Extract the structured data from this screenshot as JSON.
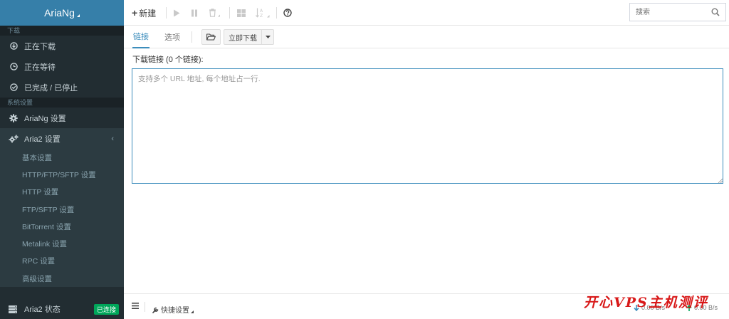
{
  "app": {
    "title": "AriaNg"
  },
  "sidebar": {
    "download_header": "下载",
    "downloading": "正在下载",
    "waiting": "正在等待",
    "stopped": "已完成 / 已停止",
    "settings_header": "系统设置",
    "ariang_settings": "AriaNg 设置",
    "aria2_settings": "Aria2 设置",
    "sub_items": [
      "基本设置",
      "HTTP/FTP/SFTP 设置",
      "HTTP 设置",
      "FTP/SFTP 设置",
      "BitTorrent 设置",
      "Metalink 设置",
      "RPC 设置",
      "高级设置"
    ],
    "aria2_status": "Aria2 状态",
    "status_badge": "已连接"
  },
  "toolbar": {
    "new_label": "新建",
    "search_placeholder": "搜索"
  },
  "tabs": {
    "links": "链接",
    "options": "选项",
    "download_now": "立即下载"
  },
  "content": {
    "links_label": "下载链接 (0 个链接):",
    "textarea_placeholder": "支持多个 URL 地址, 每个地址占一行."
  },
  "footer": {
    "quick_settings": "快捷设置",
    "download_speed": "0.00 B/s",
    "upload_speed": "0.00 B/s"
  },
  "watermark": "开心VPS主机测评",
  "colors": {
    "sidebar_bg": "#222d32",
    "brand_bg": "#367fa9",
    "accent": "#3c8dbc",
    "badge": "#00a65a"
  }
}
